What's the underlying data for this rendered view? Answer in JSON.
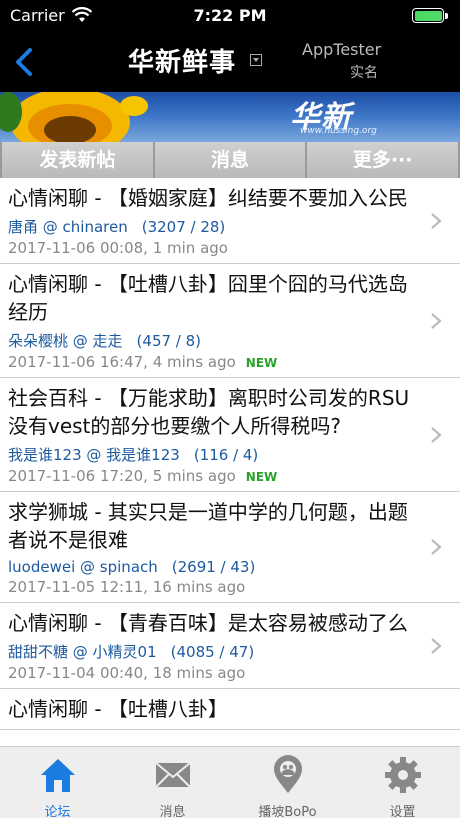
{
  "status": {
    "carrier": "Carrier",
    "time": "7:22 PM",
    "battery": 1.0
  },
  "nav": {
    "title": "华新鲜事",
    "user": "AppTester",
    "realname": "实名"
  },
  "banner": {
    "logo": "华新",
    "url": "www.hussing.org"
  },
  "actions": {
    "post": "发表新帖",
    "messages": "消息",
    "more": "更多···"
  },
  "posts": [
    {
      "title": "心情闲聊 - 【婚姻家庭】纠结要不要加入公民",
      "author": "唐甬 @ chinaren",
      "counts": "(3207 / 28)",
      "time": "2017-11-06 00:08, 1 min ago",
      "new": ""
    },
    {
      "title": "心情闲聊 - 【吐槽八卦】囧里个囧的马代选岛经历",
      "author": "朵朵樱桃 @ 走走",
      "counts": "(457 / 8)",
      "time": "2017-11-06 16:47, 4 mins ago",
      "new": "NEW"
    },
    {
      "title": "社会百科 - 【万能求助】离职时公司发的RSU没有vest的部分也要缴个人所得税吗?",
      "author": "我是谁123 @ 我是谁123",
      "counts": "(116 / 4)",
      "time": "2017-11-06 17:20, 5 mins ago",
      "new": "NEW"
    },
    {
      "title": "求学狮城 - 其实只是一道中学的几何题，出题者说不是很难",
      "author": "luodewei @ spinach",
      "counts": "(2691 / 43)",
      "time": "2017-11-05 12:11, 16 mins ago",
      "new": ""
    },
    {
      "title": "心情闲聊 - 【青春百味】是太容易被感动了么",
      "author": "甜甜不糖 @ 小精灵01",
      "counts": "(4085 / 47)",
      "time": "2017-11-04 00:40, 18 mins ago",
      "new": ""
    },
    {
      "title": "心情闲聊 - 【吐槽八卦】",
      "author": "",
      "counts": "",
      "time": "",
      "new": ""
    }
  ],
  "tabbar": {
    "forum": "论坛",
    "messages": "消息",
    "bopo": "播坡BoPo",
    "settings": "设置"
  },
  "colors": {
    "accent": "#1a7be0",
    "link": "#1d5a9e",
    "new": "#2aa22a"
  }
}
